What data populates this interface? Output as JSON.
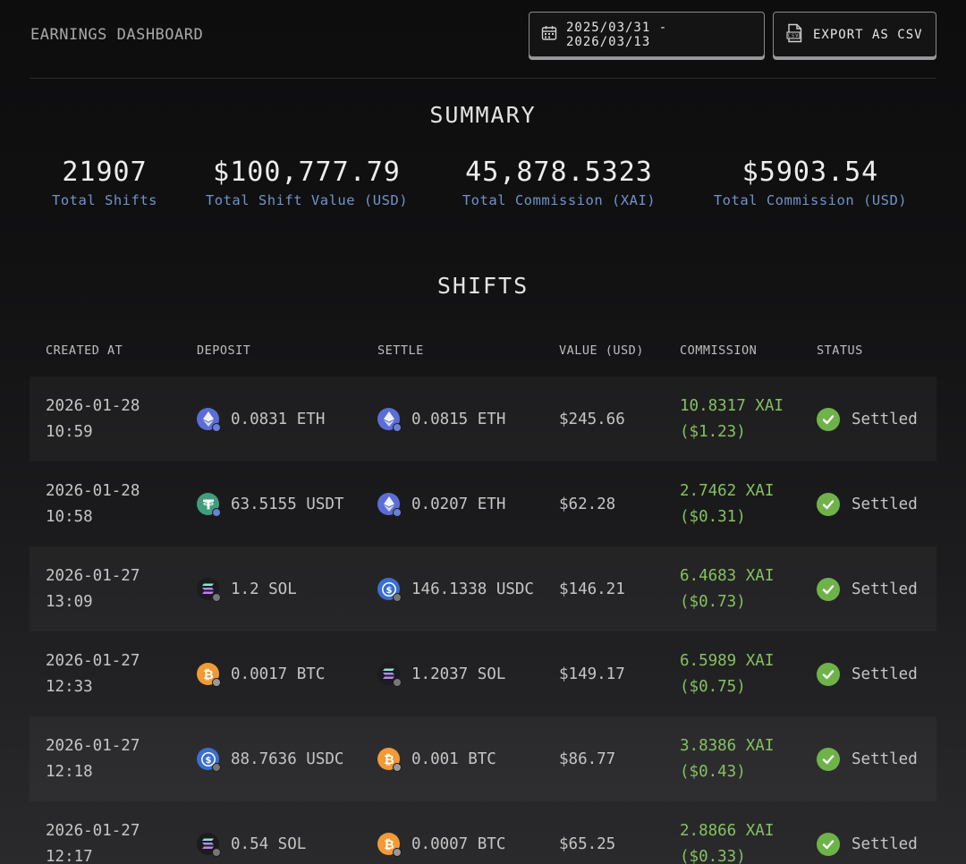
{
  "header": {
    "title": "EARNINGS DASHBOARD",
    "date_range": "2025/03/31 - 2026/03/13",
    "export_label": "EXPORT AS CSV"
  },
  "summary": {
    "title": "SUMMARY",
    "stats": [
      {
        "value": "21907",
        "label": "Total Shifts"
      },
      {
        "value": "$100,777.79",
        "label": "Total Shift Value (USD)"
      },
      {
        "value": "45,878.5323",
        "label": "Total Commission (XAI)"
      },
      {
        "value": "$5903.54",
        "label": "Total Commission (USD)"
      }
    ]
  },
  "shifts": {
    "title": "SHIFTS",
    "columns": [
      "CREATED AT",
      "DEPOSIT",
      "SETTLE",
      "VALUE (USD)",
      "COMMISSION",
      "STATUS"
    ],
    "rows": [
      {
        "date": "2026-01-28",
        "time": "10:59",
        "deposit": "0.0831 ETH",
        "deposit_icon": "eth-icon",
        "settle": "0.0815 ETH",
        "settle_icon": "eth-icon",
        "value": "$245.66",
        "commission_xai": "10.8317 XAI",
        "commission_usd": "($1.23)",
        "status": "Settled"
      },
      {
        "date": "2026-01-28",
        "time": "10:58",
        "deposit": "63.5155 USDT",
        "deposit_icon": "usdt-icon",
        "settle": "0.0207 ETH",
        "settle_icon": "eth-icon",
        "value": "$62.28",
        "commission_xai": "2.7462 XAI",
        "commission_usd": "($0.31)",
        "status": "Settled"
      },
      {
        "date": "2026-01-27",
        "time": "13:09",
        "deposit": "1.2 SOL",
        "deposit_icon": "sol-icon",
        "settle": "146.1338 USDC",
        "settle_icon": "usdc-icon",
        "value": "$146.21",
        "commission_xai": "6.4683 XAI",
        "commission_usd": "($0.73)",
        "status": "Settled"
      },
      {
        "date": "2026-01-27",
        "time": "12:33",
        "deposit": "0.0017 BTC",
        "deposit_icon": "btc-icon",
        "settle": "1.2037 SOL",
        "settle_icon": "sol-icon",
        "value": "$149.17",
        "commission_xai": "6.5989 XAI",
        "commission_usd": "($0.75)",
        "status": "Settled"
      },
      {
        "date": "2026-01-27",
        "time": "12:18",
        "deposit": "88.7636 USDC",
        "deposit_icon": "usdc-icon",
        "settle": "0.001 BTC",
        "settle_icon": "btc-icon",
        "value": "$86.77",
        "commission_xai": "3.8386 XAI",
        "commission_usd": "($0.43)",
        "status": "Settled"
      },
      {
        "date": "2026-01-27",
        "time": "12:17",
        "deposit": "0.54 SOL",
        "deposit_icon": "sol-icon",
        "settle": "0.0007 BTC",
        "settle_icon": "btc-icon",
        "value": "$65.25",
        "commission_xai": "2.8866 XAI",
        "commission_usd": "($0.33)",
        "status": "Settled"
      }
    ]
  },
  "colors": {
    "accent_label": "#6f93c8",
    "commission_green": "#86c060",
    "status_green": "#6fb24a"
  }
}
